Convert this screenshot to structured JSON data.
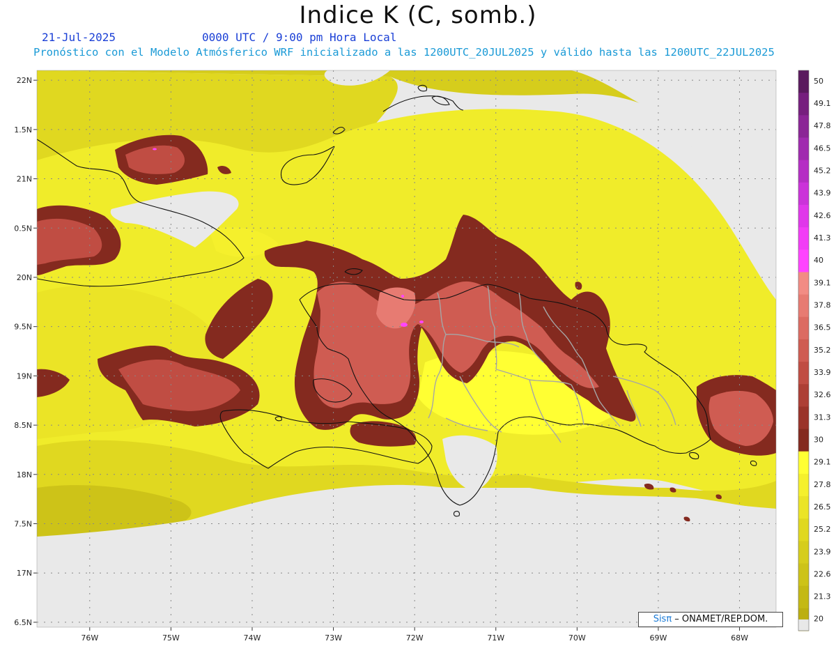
{
  "title": "Indice K (C, somb.)",
  "date_label": "21-Jul-2025",
  "time_label": "0000 UTC / 9:00 pm Hora Local",
  "forecast_label": "Pronóstico con el Modelo Atmósferico WRF inicializado a las 1200UTC_20JUL2025 y válido hasta las  1200UTC_22JUL2025",
  "map": {
    "lat_labels": [
      "22N",
      "1.5N",
      "21N",
      "0.5N",
      "20N",
      "9.5N",
      "19N",
      "8.5N",
      "18N",
      "7.5N",
      "17N",
      "6.5N"
    ],
    "lon_labels": [
      "76W",
      "75W",
      "74W",
      "73W",
      "72W",
      "71W",
      "70W",
      "69W",
      "68W"
    ],
    "extent": {
      "lon": [
        -76.65,
        -67.55
      ],
      "lat": [
        16.45,
        22.1
      ]
    }
  },
  "colorbar": {
    "labels": [
      "50",
      "49.1",
      "47.8",
      "46.5",
      "45.2",
      "43.9",
      "42.6",
      "41.3",
      "40",
      "39.1",
      "37.8",
      "36.5",
      "35.2",
      "33.9",
      "32.6",
      "31.3",
      "30",
      "29.1",
      "27.8",
      "26.5",
      "25.2",
      "23.9",
      "22.6",
      "21.3",
      "20"
    ],
    "colors": [
      "#5a1a5e",
      "#761f7e",
      "#8b2596",
      "#a02aaf",
      "#b52ec4",
      "#cb33d9",
      "#e037ea",
      "#f23cf6",
      "#ff44ff",
      "#f28c84",
      "#e77b72",
      "#dc6b62",
      "#cf5c52",
      "#c04d43",
      "#ad3f35",
      "#9a3329",
      "#842a1f",
      "#ffff33",
      "#f5f02c",
      "#ebe426",
      "#e0d820",
      "#d6cd1c",
      "#cdc318",
      "#c4b914",
      "#bcaf10"
    ],
    "bottom_color": "#e8e8e8"
  },
  "credit": {
    "brand": "Sisπ",
    "text": " – ONAMET/REP.DOM."
  }
}
